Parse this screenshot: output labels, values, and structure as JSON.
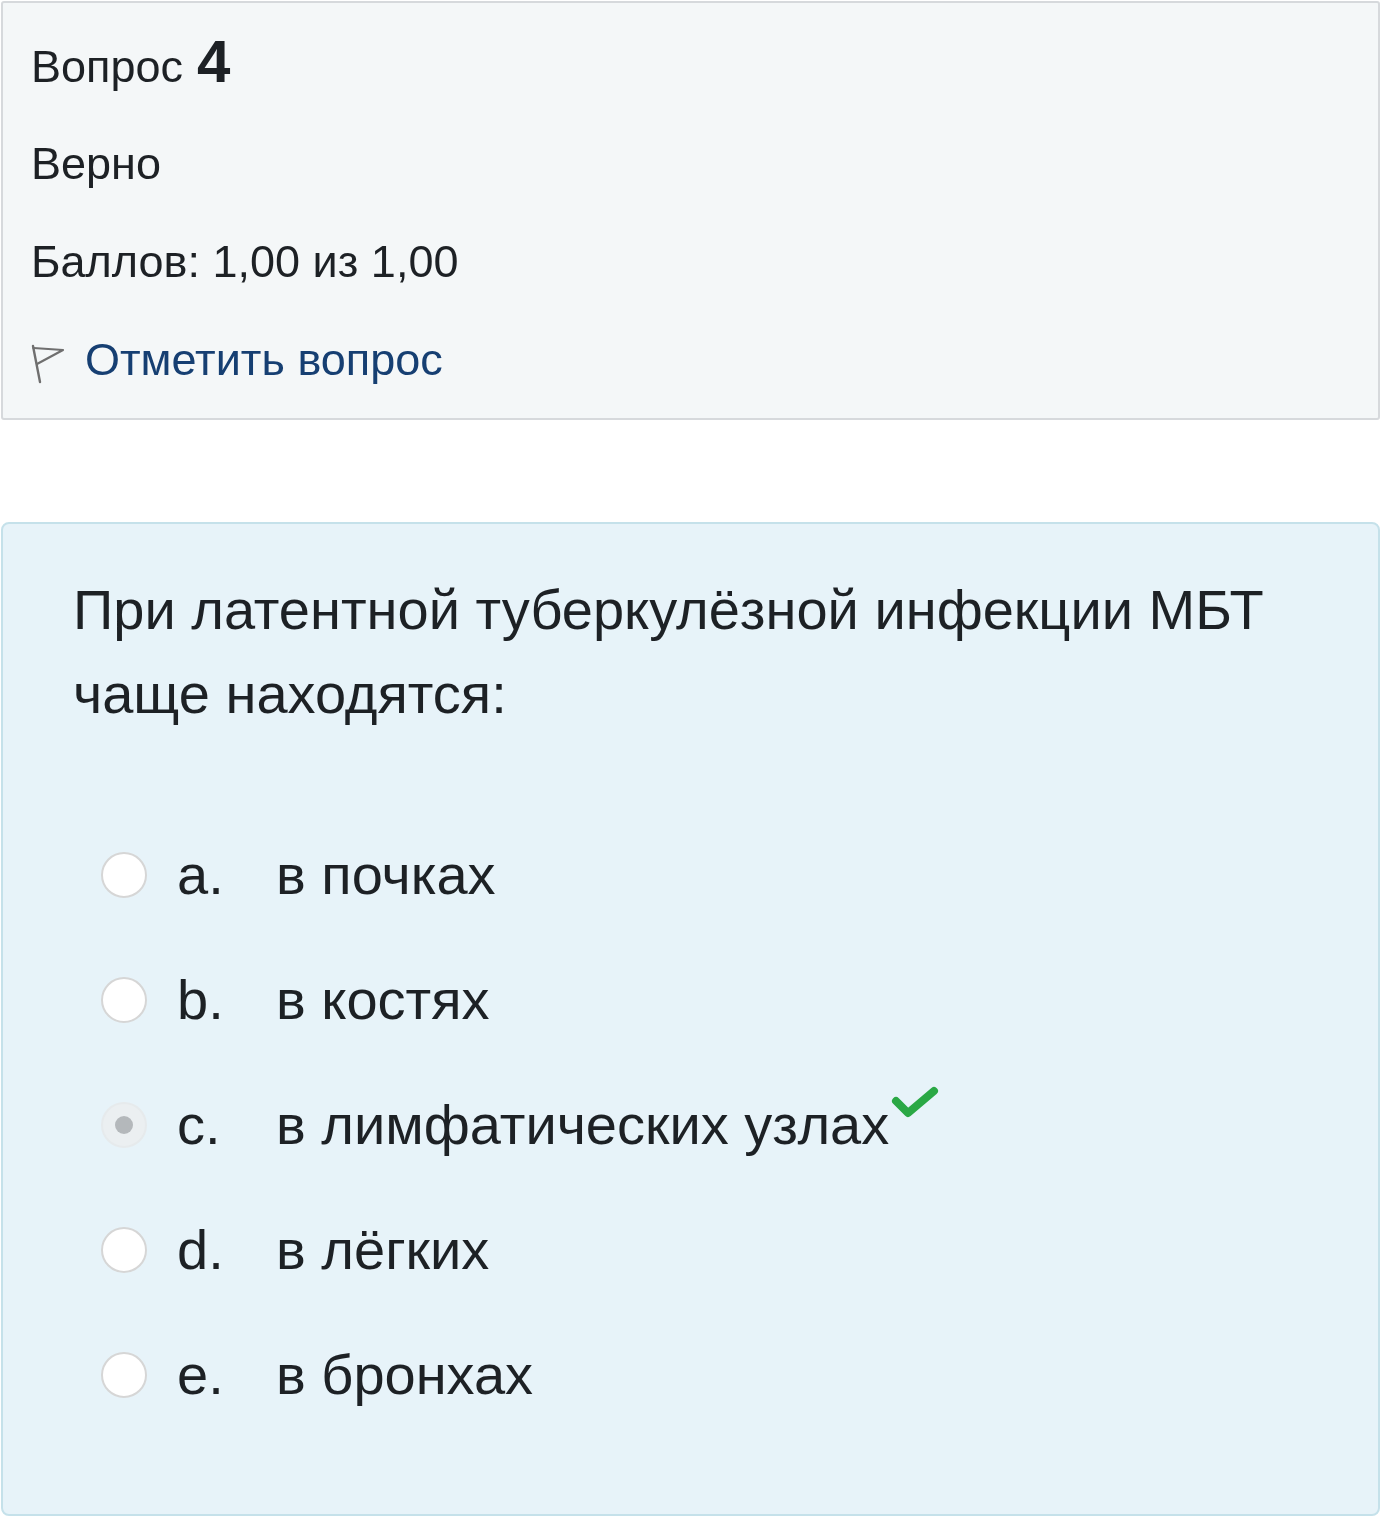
{
  "question_info": {
    "label": "Вопрос",
    "number": "4",
    "state": "Верно",
    "grade": "Баллов: 1,00 из 1,00",
    "flag_link": "Отметить вопрос"
  },
  "question": {
    "text": "При латентной туберкулёзной инфекции МБТ чаще находятся:",
    "options": [
      {
        "letter": "a.",
        "text": "в почках",
        "selected": false,
        "correct": false
      },
      {
        "letter": "b.",
        "text": "в костях",
        "selected": false,
        "correct": false
      },
      {
        "letter": "c.",
        "text": "в лимфатических узлах",
        "selected": true,
        "correct": true
      },
      {
        "letter": "d.",
        "text": "в лёгких",
        "selected": false,
        "correct": false
      },
      {
        "letter": "e.",
        "text": "в бронхах",
        "selected": false,
        "correct": false
      }
    ]
  }
}
